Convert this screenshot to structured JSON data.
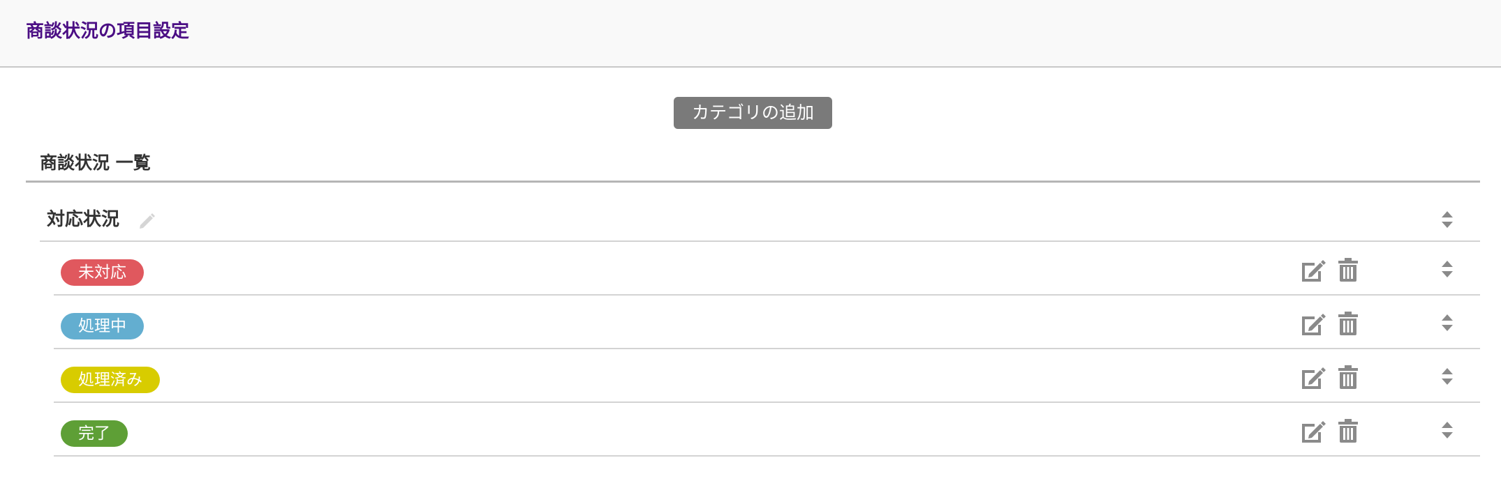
{
  "header": {
    "title": "商談状況の項目設定"
  },
  "toolbar": {
    "add_category_label": "カテゴリの追加"
  },
  "list": {
    "title": "商談状況 一覧",
    "category": {
      "name": "対応状況",
      "statuses": [
        {
          "label": "未対応",
          "color": "#e0585e"
        },
        {
          "label": "処理中",
          "color": "#63aed0"
        },
        {
          "label": "処理済み",
          "color": "#d8cc00"
        },
        {
          "label": "完了",
          "color": "#5e9f36"
        }
      ]
    }
  },
  "icons": {
    "category_edit": "pencil-icon",
    "row_edit": "edit-icon",
    "row_delete": "trash-icon",
    "sort": "sort-icon"
  },
  "colors": {
    "title": "#4b0e84",
    "button_bg": "#7a7a7a",
    "icon": "#8a8a8a"
  }
}
